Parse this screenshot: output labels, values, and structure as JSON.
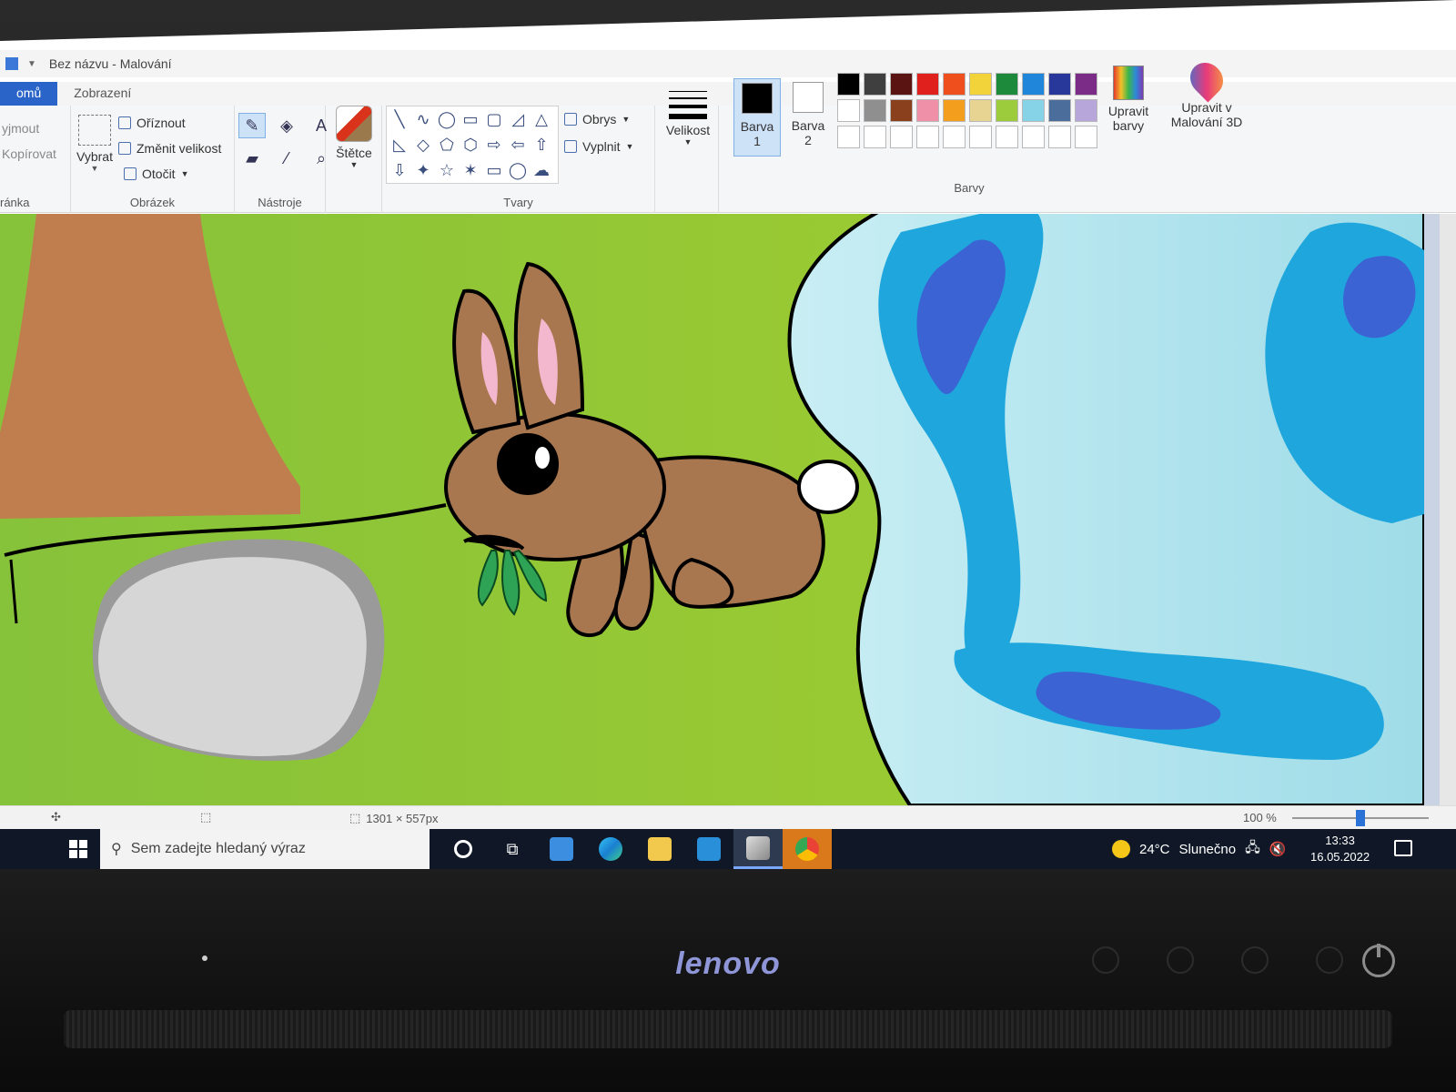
{
  "window": {
    "title": "Bez názvu - Malování"
  },
  "ribbon": {
    "tabs": [
      {
        "label": "omů"
      },
      {
        "label": "Zobrazení"
      }
    ],
    "clipboard": {
      "cut_label": "yjmout",
      "copy_label": "Kopírovat",
      "group_label": "ránka"
    },
    "image": {
      "select_label": "Vybrat",
      "crop_label": "Oříznout",
      "resize_label": "Změnit velikost",
      "rotate_label": "Otočit",
      "group_label": "Obrázek"
    },
    "tools": {
      "group_label": "Nástroje",
      "items": [
        {
          "name": "pencil",
          "glyph": "✎"
        },
        {
          "name": "fill",
          "glyph": "◈"
        },
        {
          "name": "text",
          "glyph": "A"
        },
        {
          "name": "eraser",
          "glyph": "▰"
        },
        {
          "name": "color-picker",
          "glyph": "⁄"
        },
        {
          "name": "magnifier",
          "glyph": "⌕"
        }
      ]
    },
    "brushes": {
      "label": "Štětce"
    },
    "shapes": {
      "group_label": "Tvary",
      "outline_label": "Obrys",
      "fill_label": "Vyplnit",
      "items": [
        "╲",
        "∿",
        "◯",
        "▭",
        "▢",
        "◿",
        "△",
        "◺",
        "◇",
        "⬠",
        "⬡",
        "⇨",
        "⇦",
        "⇧",
        "⇩",
        "✦",
        "☆",
        "✶",
        "▭",
        "◯",
        "☁"
      ]
    },
    "size": {
      "label": "Velikost"
    },
    "color1": {
      "label_top": "Barva",
      "label_bottom": "1",
      "color": "#000000"
    },
    "color2": {
      "label_top": "Barva",
      "label_bottom": "2",
      "color": "#ffffff"
    },
    "colors": {
      "group_label": "Barvy",
      "palette": [
        "#000000",
        "#3f3f3f",
        "#5a1512",
        "#e0201c",
        "#ef4f1c",
        "#f2d33a",
        "#1c8a3a",
        "#1f86d9",
        "#27379a",
        "#7a2c86",
        "#ffffff",
        "#8f8f8f",
        "#8a3f1d",
        "#f08fa8",
        "#f49e1d",
        "#e7d493",
        "#9ccc3c",
        "#86d2e6",
        "#4b6d9c",
        "#b7a6d9",
        "#ffffff",
        "#ffffff",
        "#ffffff",
        "#ffffff",
        "#ffffff",
        "#ffffff",
        "#ffffff",
        "#ffffff",
        "#ffffff",
        "#ffffff"
      ]
    },
    "edit_colors": {
      "label_top": "Upravit",
      "label_bottom": "barvy"
    },
    "paint3d": {
      "label_top": "Upravit v",
      "label_bottom": "Malování 3D"
    }
  },
  "status": {
    "dimensions": "1301 × 557px",
    "zoom": "100 %"
  },
  "taskbar": {
    "search_placeholder": "Sem zadejte hledaný výraz",
    "weather_temp": "24°C",
    "weather_text": "Slunečno",
    "time": "13:33",
    "date": "16.05.2022"
  },
  "device": {
    "brand": "lenovo"
  }
}
